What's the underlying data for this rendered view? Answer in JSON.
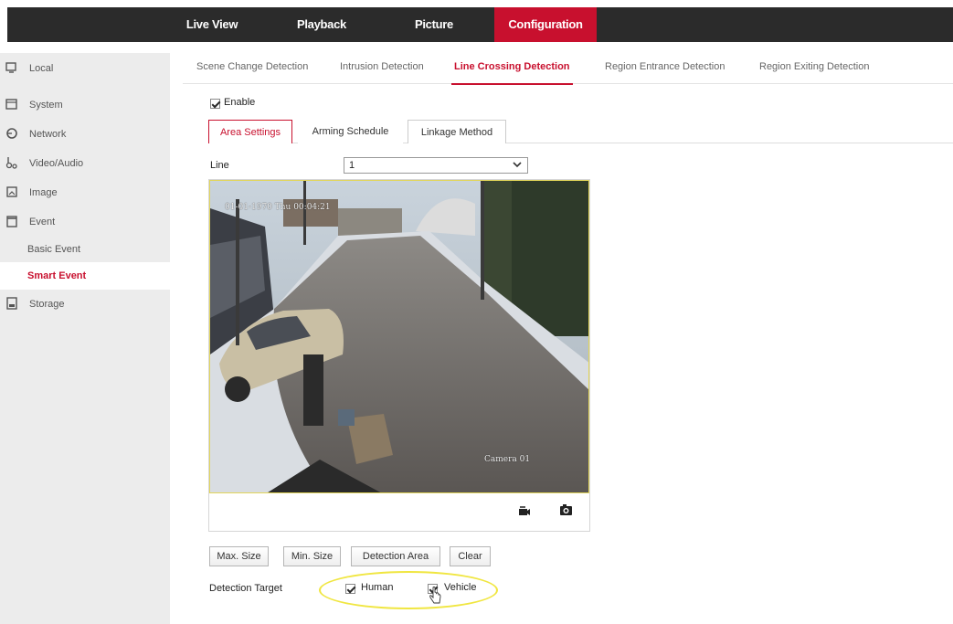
{
  "top_nav": {
    "items": [
      {
        "label": "Live View"
      },
      {
        "label": "Playback"
      },
      {
        "label": "Picture"
      },
      {
        "label": "Configuration"
      }
    ],
    "active_color": "#c8102e"
  },
  "sidebar": {
    "items": [
      {
        "label": "Local",
        "icon": "monitor-icon"
      },
      {
        "label": "System",
        "icon": "system-icon"
      },
      {
        "label": "Network",
        "icon": "network-icon"
      },
      {
        "label": "Video/Audio",
        "icon": "video-audio-icon"
      },
      {
        "label": "Image",
        "icon": "image-icon"
      },
      {
        "label": "Event",
        "icon": "event-icon"
      },
      {
        "label": "Basic Event"
      },
      {
        "label": "Smart Event"
      },
      {
        "label": "Storage",
        "icon": "storage-icon"
      }
    ]
  },
  "sub_tabs": [
    {
      "label": "Scene Change Detection"
    },
    {
      "label": "Intrusion Detection"
    },
    {
      "label": "Line Crossing Detection"
    },
    {
      "label": "Region Entrance Detection"
    },
    {
      "label": "Region Exiting Detection"
    }
  ],
  "enable": {
    "label": "Enable",
    "checked": true
  },
  "inner_tabs": [
    {
      "label": "Area Settings"
    },
    {
      "label": "Arming Schedule"
    },
    {
      "label": "Linkage Method"
    }
  ],
  "line_field": {
    "label": "Line",
    "value": "1"
  },
  "video": {
    "timestamp": "01-01-1970 Thu 00:04:21",
    "camera_name": "Camera 01",
    "toolbar": [
      {
        "icon": "record-icon"
      },
      {
        "icon": "camera-icon"
      }
    ]
  },
  "buttons": {
    "max_size": "Max. Size",
    "min_size": "Min. Size",
    "detection_area": "Detection Area",
    "clear": "Clear"
  },
  "detection_target": {
    "label": "Detection Target",
    "options": [
      {
        "label": "Human",
        "checked": true
      },
      {
        "label": "Vehicle",
        "checked": true
      }
    ]
  }
}
